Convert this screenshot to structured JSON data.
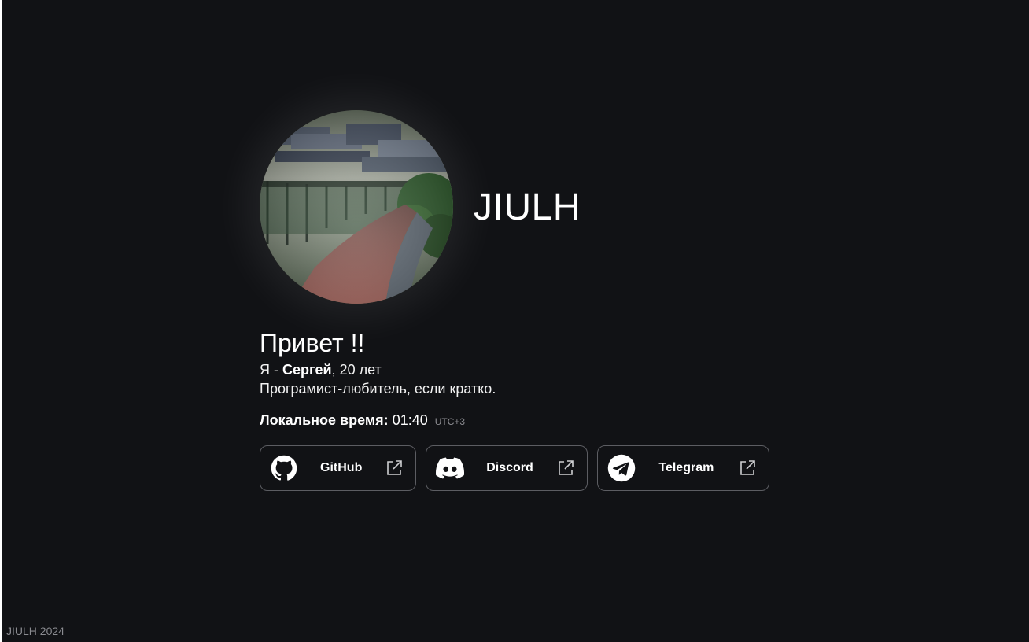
{
  "profile": {
    "site_name": "JIULH",
    "avatar_alt": "avatar"
  },
  "intro": {
    "greeting": "Привет !!",
    "line1_prefix": "Я - ",
    "line1_name": "Сергей",
    "line1_suffix": ", 20 лет",
    "line2": "Програмист-любитель, если кратко."
  },
  "local_time": {
    "label": "Локальное время:",
    "value": "01:40",
    "zone": "UTC+3"
  },
  "links": [
    {
      "label": "GitHub",
      "icon": "github-icon"
    },
    {
      "label": "Discord",
      "icon": "discord-icon"
    },
    {
      "label": "Telegram",
      "icon": "telegram-icon"
    }
  ],
  "footer": {
    "text": "JIULH 2024"
  },
  "colors": {
    "background": "#111215",
    "text": "#ffffff",
    "muted": "#8a8b90",
    "button_border": "#5c5d62"
  }
}
